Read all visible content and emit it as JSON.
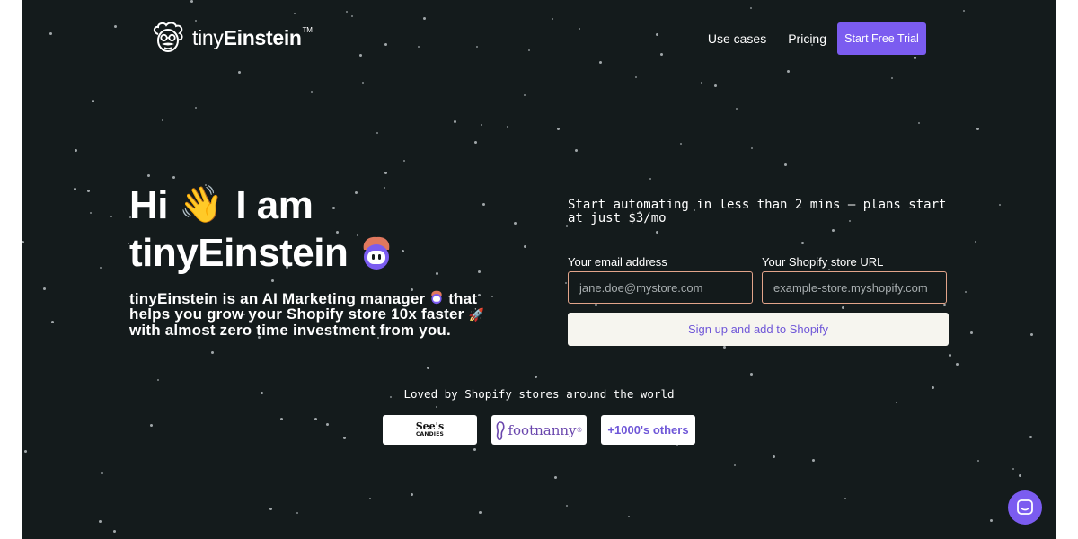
{
  "header": {
    "logo_text_light": "tiny",
    "logo_text_bold": "Einstein",
    "logo_trademark": "TM",
    "nav": [
      {
        "label": "Use cases"
      },
      {
        "label": "Pricing"
      }
    ],
    "cta_label": "Start Free Trial"
  },
  "hero": {
    "title_line1_a": "Hi",
    "title_wave": "👋",
    "title_line1_b": "I am",
    "title_line2": "tinyEinstein",
    "subtitle_a": "tinyEinstein is an AI Marketing manager",
    "subtitle_b": "that helps you grow your Shopify store 10x faster",
    "subtitle_rocket": "🚀",
    "subtitle_c": "with almost zero time investment from you."
  },
  "signup": {
    "promo": "Start automating in less than 2 mins – plans start at just $3/mo",
    "email_label": "Your email address",
    "email_placeholder": "jane.doe@mystore.com",
    "store_label": "Your Shopify store URL",
    "store_placeholder": "example-store.myshopify.com",
    "button_label": "Sign up and add to Shopify"
  },
  "social_proof": {
    "heading": "Loved by Shopify stores around the world",
    "logos": [
      {
        "name": "See's",
        "sub": "CANDIES"
      },
      {
        "name": "footnanny",
        "mark": "®"
      }
    ],
    "others_label": "+1000's others"
  },
  "colors": {
    "background": "#141b1c",
    "accent": "#7b5cf0",
    "input_border": "#e2a48a",
    "button_bg": "#f6f5ef"
  },
  "icons": {
    "logo": "einstein-face-icon",
    "bot": "robot-einstein-icon",
    "chat": "chat-bubble-icon",
    "footnanny": "foot-icon"
  }
}
